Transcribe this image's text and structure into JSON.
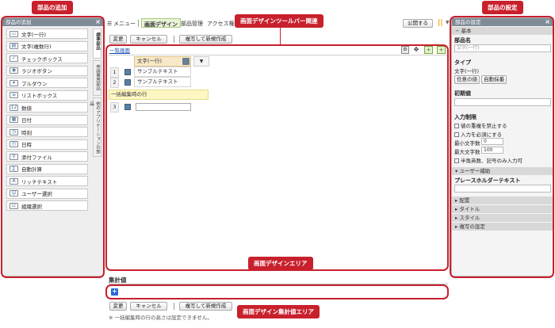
{
  "callouts": {
    "add_parts": "部品の追加",
    "toolbar": "画面デザインツールバー関連",
    "settings": "部品の設定",
    "design_area": "画面デザインエリア",
    "aggregate_area": "画面デザイン集計値エリア"
  },
  "left_panel": {
    "title": "部品の追加",
    "items": [
      {
        "label": "文字(一行)",
        "icon": "single-line-text-icon"
      },
      {
        "label": "文字(複数行)",
        "icon": "multi-line-text-icon"
      },
      {
        "label": "チェックボックス",
        "icon": "checkbox-icon"
      },
      {
        "label": "ラジオボタン",
        "icon": "radio-icon"
      },
      {
        "label": "プルダウン",
        "icon": "pulldown-icon"
      },
      {
        "label": "リストボックス",
        "icon": "listbox-icon"
      },
      {
        "label": "数値",
        "icon": "number-icon"
      },
      {
        "label": "日付",
        "icon": "date-icon"
      },
      {
        "label": "時刻",
        "icon": "clock-icon"
      },
      {
        "label": "日時",
        "icon": "datetime-icon"
      },
      {
        "label": "添付ファイル",
        "icon": "attachment-icon"
      },
      {
        "label": "自動計算",
        "icon": "calc-icon"
      },
      {
        "label": "リッチテキスト",
        "icon": "richtext-icon"
      },
      {
        "label": "ユーザー選択",
        "icon": "user-select-icon"
      },
      {
        "label": "組織選択",
        "icon": "org-select-icon"
      }
    ],
    "tabs": [
      "標準部品",
      "申請書用部品",
      "他のアプリケーションの部品"
    ]
  },
  "nav": {
    "menu": "メニュー",
    "items": [
      "画面デザイン",
      "部品管理",
      "アクセス権"
    ],
    "publish": "公開する"
  },
  "toolbar": {
    "change": "変更",
    "cancel": "キャンセル",
    "copy_new": "複写して新規作成"
  },
  "design": {
    "list_screen_link": "一覧画面",
    "column_header": "文字(一行)",
    "rows": [
      {
        "num": "1",
        "text": "サンプルテキスト"
      },
      {
        "num": "2",
        "text": "サンプルテキスト"
      }
    ],
    "bulk_row": "一括編集時の行",
    "row3": "3"
  },
  "aggregate": {
    "title": "集計値",
    "note": "※ 一括編集時の行の高さは設定できません。"
  },
  "right_panel": {
    "title": "部品の設定",
    "basic": "基本",
    "part_name_label": "部品名",
    "part_name_value": "文字(一行)",
    "type_label": "タイプ",
    "type_value": "文字(一行)",
    "type_btn1": "任意の値",
    "type_btn2": "自動採番",
    "initial_label": "初期値",
    "input_limit_label": "入力制限",
    "no_dup": "値の重複を禁止する",
    "required": "入力を必須にする",
    "min_label": "最小文字数",
    "min_value": "0",
    "max_label": "最大文字数",
    "max_value": "100",
    "alnum_only": "半角英数、記号のみ入力可",
    "user_assist": "ユーザー補助",
    "placeholder_label": "プレースホルダーテキスト",
    "sections": [
      "配置",
      "タイトル",
      "スタイル",
      "複写の設定"
    ]
  },
  "colors": {
    "callout": "#c8202c",
    "panel_header": "#7f8c98",
    "accent": "#f0a000"
  }
}
